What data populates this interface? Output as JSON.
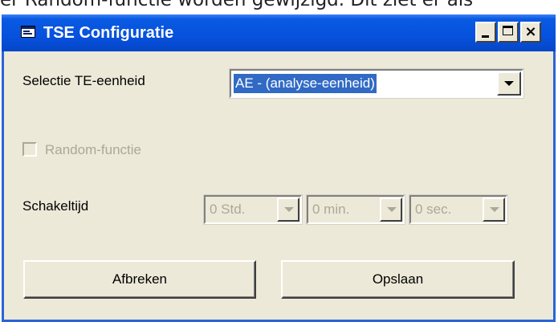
{
  "background_text": "er Random-functie worden gewijzigd. Dit ziet er als",
  "window": {
    "title": "TSE Configuratie",
    "controls": {
      "minimize": "minimize",
      "maximize": "maximize",
      "close": "×"
    }
  },
  "form": {
    "te_unit_label": "Selectie TE-eenheid",
    "te_unit_value": "AE - (analyse-eenheid)",
    "random_label": "Random-functie",
    "random_checked": false,
    "switch_time_label": "Schakeltijd",
    "hours_value": "0 Std.",
    "minutes_value": "0 min.",
    "seconds_value": "0 sec."
  },
  "buttons": {
    "cancel": "Afbreken",
    "save": "Opslaan"
  },
  "colors": {
    "titlebar": "#0651dd",
    "window_bg": "#ece9d8",
    "selection": "#316ac5",
    "disabled_text": "#aca899"
  }
}
